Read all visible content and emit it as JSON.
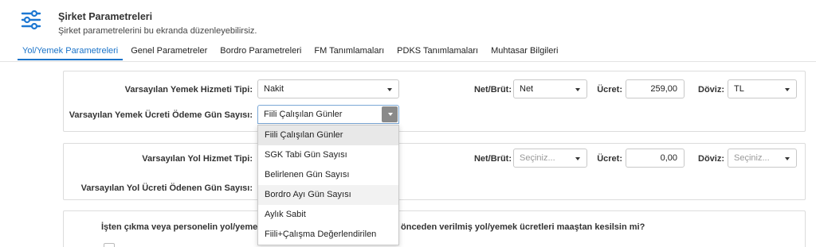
{
  "header": {
    "title": "Şirket Parametreleri",
    "subtitle": "Şirket parametrelerini bu ekranda düzenleyebilirsiz.",
    "icon": "sliders-icon"
  },
  "tabs": [
    {
      "label": "Yol/Yemek Parametreleri",
      "active": true
    },
    {
      "label": "Genel Parametreler"
    },
    {
      "label": "Bordro Parametreleri"
    },
    {
      "label": "FM Tanımlamaları"
    },
    {
      "label": "PDKS Tanımlamaları"
    },
    {
      "label": "Muhtasar Bilgileri"
    }
  ],
  "yemek": {
    "service_type_label": "Varsayılan Yemek Hizmeti Tipi:",
    "service_type_value": "Nakit",
    "payment_days_label": "Varsayılan Yemek Ücreti Ödeme Gün Sayısı:",
    "payment_days_value": "Fiili Çalışılan Günler",
    "net_brut_label": "Net/Brüt:",
    "net_brut_value": "Net",
    "ucret_label": "Ücret:",
    "ucret_value": "259,00",
    "doviz_label": "Döviz:",
    "doviz_value": "TL"
  },
  "yol": {
    "service_type_label": "Varsayılan Yol Hizmet Tipi:",
    "payment_days_label": "Varsayılan Yol Ücreti Ödenen Gün Sayısı:",
    "net_brut_label": "Net/Brüt:",
    "net_brut_placeholder": "Seçiniz...",
    "ucret_label": "Ücret:",
    "ucret_value": "0,00",
    "doviz_label": "Döviz:",
    "doviz_placeholder": "Seçiniz..."
  },
  "dropdown": {
    "options": [
      "Fiili Çalışılan Günler",
      "SGK Tabi Gün Sayısı",
      "Belirlenen Gün Sayısı",
      "Bordro Ayı Gün Sayısı",
      "Aylık Sabit",
      "Fiili+Çalışma Değerlendirilen"
    ],
    "selected": "Fiili Çalışılan Günler"
  },
  "deduction": {
    "question_left": "İşten çıkma veya personelin yol/yemek h",
    "question_right": "önceden verilmiş yol/yemek ücretleri maaştan kesilsin mi?"
  },
  "colors": {
    "accent": "#1a73c9",
    "icon_blue": "#1e78d2"
  }
}
